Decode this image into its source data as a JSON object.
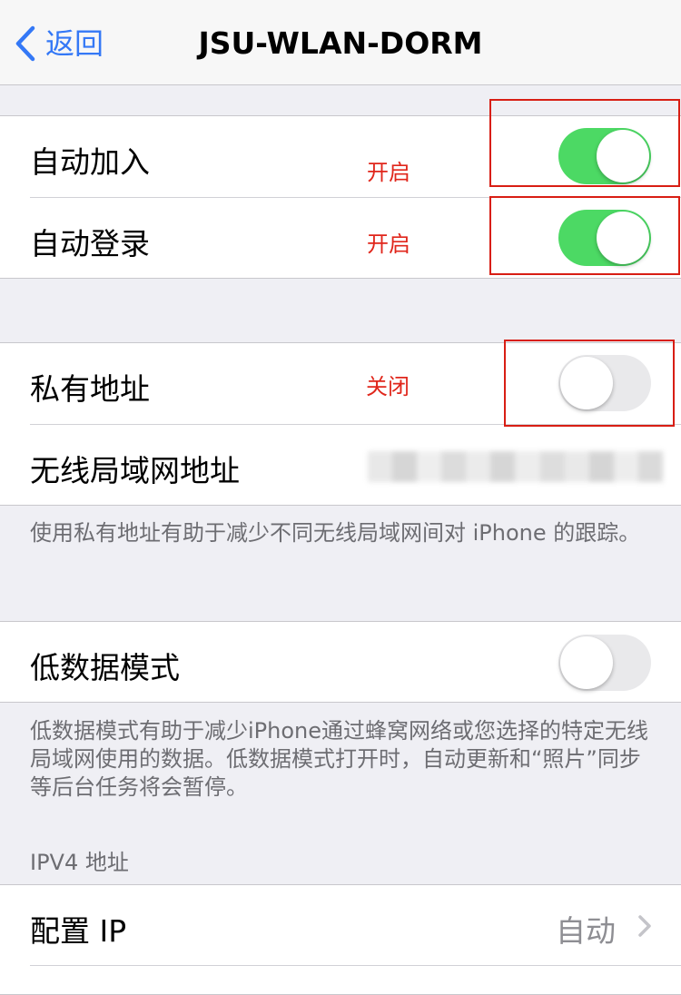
{
  "navbar": {
    "back_label": "返回",
    "title": "JSU-WLAN-DORM"
  },
  "group1": {
    "auto_join": {
      "label": "自动加入",
      "annotation": "开启",
      "toggle_on": true
    },
    "auto_login": {
      "label": "自动登录",
      "annotation": "开启",
      "toggle_on": true
    }
  },
  "group2": {
    "private_address": {
      "label": "私有地址",
      "annotation": "关闭",
      "toggle_on": false
    },
    "wlan_address": {
      "label": "无线局域网地址"
    },
    "footnote": "使用私有地址有助于减少不同无线局域网间对 iPhone 的跟踪。"
  },
  "group3": {
    "low_data_mode": {
      "label": "低数据模式",
      "toggle_on": false
    },
    "footnote": "低数据模式有助于减少iPhone通过蜂窝网络或您选择的特定无线局域网使用的数据。低数据模式打开时，自动更新和“照片”同步等后台任务将会暂停。"
  },
  "ipv4": {
    "header": "IPV4 地址",
    "configure_ip": {
      "label": "配置 IP",
      "value": "自动"
    }
  },
  "colors": {
    "accent": "#3478f6",
    "toggle_on": "#4cd964",
    "annotation": "#e0261b"
  },
  "icons": {
    "back": "chevron-left-icon",
    "disclosure": "chevron-right-icon"
  }
}
